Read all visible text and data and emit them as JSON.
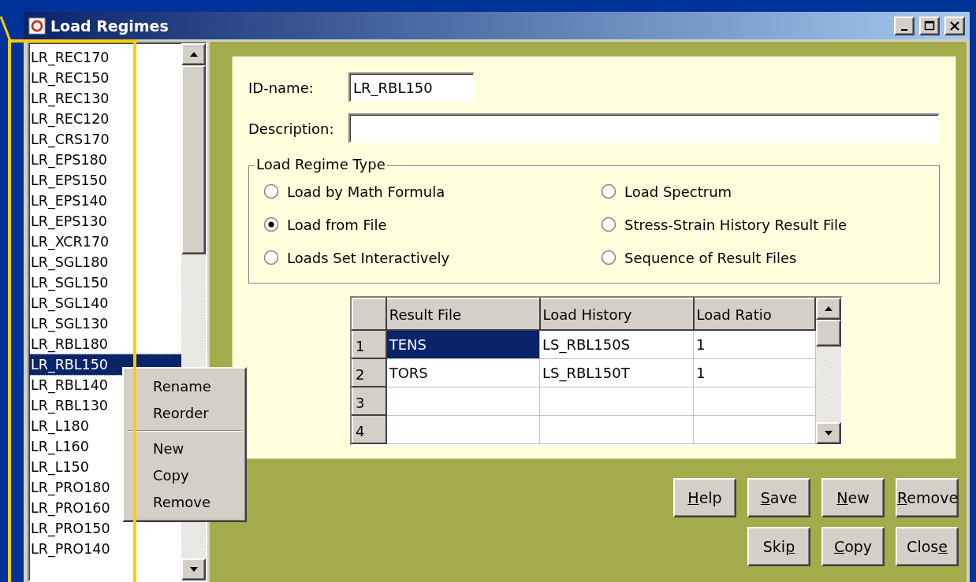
{
  "window": {
    "title": "Load Regimes"
  },
  "regime_list": {
    "items": [
      {
        "label": "LR_REC170",
        "selected": false
      },
      {
        "label": "LR_REC150",
        "selected": false
      },
      {
        "label": "LR_REC130",
        "selected": false
      },
      {
        "label": "LR_REC120",
        "selected": false
      },
      {
        "label": "LR_CRS170",
        "selected": false
      },
      {
        "label": "LR_EPS180",
        "selected": false
      },
      {
        "label": "LR_EPS150",
        "selected": false
      },
      {
        "label": "LR_EPS140",
        "selected": false
      },
      {
        "label": "LR_EPS130",
        "selected": false
      },
      {
        "label": "LR_XCR170",
        "selected": false
      },
      {
        "label": "LR_SGL180",
        "selected": false
      },
      {
        "label": "LR_SGL150",
        "selected": false
      },
      {
        "label": "LR_SGL140",
        "selected": false
      },
      {
        "label": "LR_SGL130",
        "selected": false
      },
      {
        "label": "LR_RBL180",
        "selected": false
      },
      {
        "label": "LR_RBL150",
        "selected": true
      },
      {
        "label": "LR_RBL140",
        "selected": false
      },
      {
        "label": "LR_RBL130",
        "selected": false
      },
      {
        "label": "LR_L180",
        "selected": false
      },
      {
        "label": "LR_L160",
        "selected": false
      },
      {
        "label": "LR_L150",
        "selected": false
      },
      {
        "label": "LR_PRO180",
        "selected": false
      },
      {
        "label": "LR_PRO160",
        "selected": false
      },
      {
        "label": "LR_PRO150",
        "selected": false
      },
      {
        "label": "LR_PRO140",
        "selected": false
      }
    ]
  },
  "context_menu": {
    "groups": [
      [
        "Rename",
        "Reorder"
      ],
      [
        "New",
        "Copy",
        "Remove"
      ]
    ]
  },
  "form": {
    "id_name": {
      "label": "ID-name:",
      "value": "LR_RBL150"
    },
    "description": {
      "label": "Description:"
    }
  },
  "regime_type": {
    "title": "Load Regime Type",
    "options": [
      {
        "label": "Load by Math Formula",
        "selected": false
      },
      {
        "label": "Load Spectrum",
        "selected": false
      },
      {
        "label": "Load from File",
        "selected": true
      },
      {
        "label": "Stress-Strain History Result File",
        "selected": false
      },
      {
        "label": "Loads Set Interactively",
        "selected": false
      },
      {
        "label": "Sequence of Result Files",
        "selected": false
      }
    ]
  },
  "table": {
    "columns": [
      "Result File",
      "Load History",
      "Load Ratio"
    ],
    "rows": [
      {
        "number": "1",
        "cells": [
          {
            "text": "TENS",
            "selected": true
          },
          {
            "text": "LS_RBL150S",
            "selected": false
          },
          {
            "text": "1",
            "selected": false
          }
        ]
      },
      {
        "number": "2",
        "cells": [
          {
            "text": "TORS",
            "selected": false
          },
          {
            "text": "LS_RBL150T",
            "selected": false
          },
          {
            "text": "1",
            "selected": false
          }
        ]
      },
      {
        "number": "3",
        "cells": []
      },
      {
        "number": "4",
        "cells": []
      }
    ]
  },
  "buttons": [
    [
      {
        "key": "H",
        "post": "elp"
      },
      {
        "key": "S",
        "post": "ave"
      },
      {
        "key": "N",
        "post": "ew"
      },
      {
        "key": "R",
        "post": "emove"
      }
    ],
    [
      {
        "pre": "Ski",
        "key": "p"
      },
      {
        "key": "C",
        "post": "opy"
      },
      {
        "pre": "Clos",
        "key": "e"
      }
    ]
  ]
}
